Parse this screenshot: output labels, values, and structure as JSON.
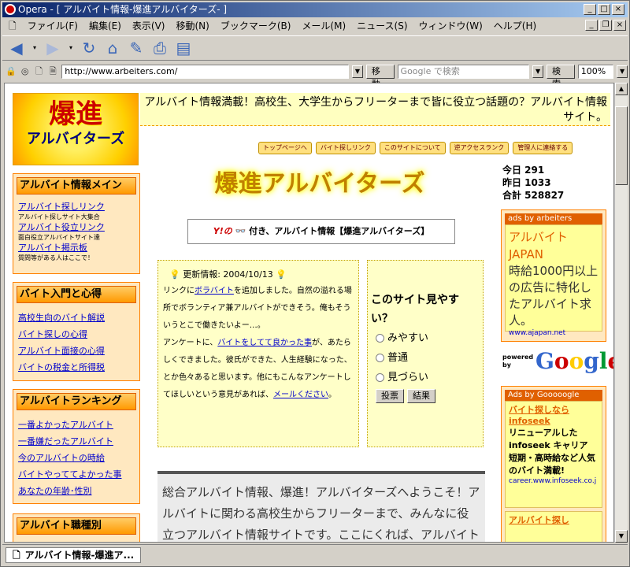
{
  "browser": {
    "title": "Opera - [ アルバイト情報-爆進アルバイターズ- ]",
    "menu": [
      "ファイル(F)",
      "編集(E)",
      "表示(V)",
      "移動(N)",
      "ブックマーク(B)",
      "メール(M)",
      "ニュース(S)",
      "ウィンドウ(W)",
      "ヘルプ(H)"
    ],
    "address": "http://www.arbeiters.com/",
    "go_label": "移動",
    "search_placeholder": "Google で検索",
    "search_label": "検索",
    "zoom": "100%",
    "tab_title": "アルバイト情報-爆進ア..."
  },
  "page": {
    "logo_line1": "爆進",
    "logo_line2": "アルバイターズ",
    "tagline": "アルバイト情報満載！高校生、大学生からフリーターまで皆に役立つ話題の？アルバイト情報サイト。",
    "nav": [
      "トップページへ",
      "バイト探しリンク",
      "このサイトについて",
      "逆アクセスランク",
      "管理人に連絡する"
    ],
    "sidebar": [
      {
        "head": "アルバイト情報メイン",
        "items": [
          {
            "link": "アルバイト探しリンク",
            "note": "アルバイト探しサイト大集合"
          },
          {
            "link": "アルバイト役立リンク",
            "note": "面白役立アルバイトサイト達"
          },
          {
            "link": "アルバイト掲示板",
            "note": "質問等がある人はここで！"
          }
        ]
      },
      {
        "head": "バイト入門と心得",
        "links": [
          "高校生向のバイト解説",
          "バイト探しの心得",
          "アルバイト面接の心得",
          "バイトの税金と所得税"
        ]
      },
      {
        "head": "アルバイトランキング",
        "links": [
          "一番よかったアルバイト",
          "一番嫌だったアルバイト",
          "今のアルバイトの時給",
          "バイトやっててよかった事",
          "あなたの年齢･性別"
        ]
      },
      {
        "head": "アルバイト職種別"
      }
    ],
    "mid_logo_a": "爆進",
    "mid_logo_b": "アルバイターズ",
    "ybanner_prefix": "Y!の",
    "ybanner_text": "付き、アルバイト情報【爆進アルバイターズ】",
    "news": {
      "title": "更新情報: 2004/10/13",
      "p1a": "リンクに",
      "p1link": "ボラバイト",
      "p1b": "を追加しました。自然の溢れる場所でボランティア兼アルバイトができそう。俺もそういうとこで働きたいよー…。",
      "p2a": "アンケートに、",
      "p2link": "バイトをしてて良かった事",
      "p2b": "が、あたらしくできました。彼氏ができた、人生経験になった、とか色々あると思います。他にもこんなアンケートしてほしいという意見があれば、",
      "p2link2": "メールください",
      "p2c": "。"
    },
    "poll": {
      "question": "このサイト見やすい？",
      "options": [
        "みやすい",
        "普通",
        "見づらい"
      ],
      "vote": "投票",
      "result": "結果"
    },
    "welcome": "総合アルバイト情報、爆進！アルバイターズへようこそ！アルバイトに関わる高校生からフリーターまで、みんなに役立つアルバイト情報サイトです。ここにくれば、アルバイト関連は",
    "counter": {
      "today": "今日 291",
      "yesterday": "昨日 1033",
      "total": "合計 528827"
    },
    "ad1": {
      "head": "ads by arbeiters",
      "title": "アルバイト JAPAN",
      "text": "時給1000円以上の広告に特化したアルバイト求人。",
      "url": "www.ajapan.net"
    },
    "powered": "powered by",
    "google": "Google",
    "ad2": {
      "head": "Ads by Gooooogle",
      "title": "バイト探しなら infoseek",
      "text": "リニューアルした infoseek キャリア 短期・高時給など人気のバイト満載!",
      "url": "career.www.infoseek.co.j",
      "title2": "アルバイト探し"
    }
  }
}
